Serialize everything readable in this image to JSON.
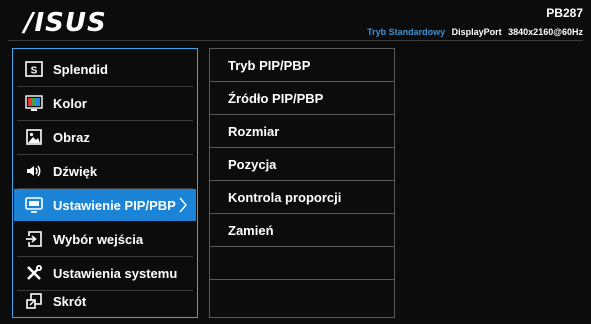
{
  "brand": {
    "logo_text": "/ISUS"
  },
  "header": {
    "model": "PB287",
    "mode": "Tryb Standardowy",
    "input": "DisplayPort",
    "resolution": "3840x2160@60Hz"
  },
  "main_menu": {
    "items": [
      {
        "label": "Splendid",
        "icon": "splendid-icon"
      },
      {
        "label": "Kolor",
        "icon": "color-icon"
      },
      {
        "label": "Obraz",
        "icon": "image-icon"
      },
      {
        "label": "Dźwięk",
        "icon": "speaker-icon"
      },
      {
        "label": "Ustawienie PIP/PBP",
        "icon": "pip-monitor-icon",
        "selected": true
      },
      {
        "label": "Wybór wejścia",
        "icon": "input-select-icon"
      },
      {
        "label": "Ustawienia systemu",
        "icon": "tools-icon"
      },
      {
        "label": "Skrót",
        "icon": "shortcut-icon"
      }
    ]
  },
  "sub_menu": {
    "items": [
      {
        "label": "Tryb PIP/PBP"
      },
      {
        "label": "Źródło PIP/PBP"
      },
      {
        "label": "Rozmiar"
      },
      {
        "label": "Pozycja"
      },
      {
        "label": "Kontrola proporcji"
      },
      {
        "label": "Zamień"
      },
      {
        "label": ""
      },
      {
        "label": ""
      }
    ]
  },
  "colors": {
    "background": "#0c0c0c",
    "selection": "#1b84d6",
    "accent_border": "#3fa5e8",
    "mode_text": "#3f8fd0"
  }
}
